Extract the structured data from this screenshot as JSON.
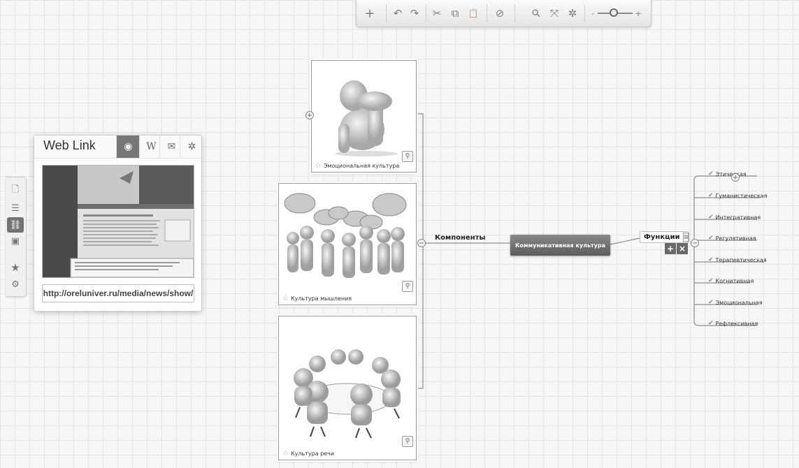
{
  "toolbar": {
    "add_icon": "+",
    "undo_icon": "↶",
    "redo_icon": "↷",
    "cut_icon": "✂",
    "copy_icon": "⧉",
    "paste_icon": "📋",
    "clear_icon": "⊘",
    "search_icon": "⚲",
    "fit_icon": "⤧",
    "layout_icon": "✲",
    "zoom_minus": "-",
    "zoom_plus": "+",
    "zoom_level": 0.45
  },
  "sidebar": {
    "items": [
      {
        "icon": "document-icon",
        "glyph": "🗋"
      },
      {
        "icon": "list-icon",
        "glyph": "☰"
      },
      {
        "icon": "link-icon",
        "glyph": "⛓"
      },
      {
        "icon": "image-icon",
        "glyph": "▣"
      },
      {
        "icon": "star-icon",
        "glyph": "★"
      },
      {
        "icon": "theme-icon",
        "glyph": "⚙"
      }
    ]
  },
  "weblink": {
    "title": "Web Link",
    "tabs": [
      {
        "icon": "web-icon",
        "glyph": "◉"
      },
      {
        "icon": "wikipedia-icon",
        "glyph": "W"
      },
      {
        "icon": "mail-icon",
        "glyph": "✉"
      },
      {
        "icon": "mindmap-icon",
        "glyph": "✲"
      }
    ],
    "url": "http://oreluniver.ru/media/news/show/"
  },
  "nodes": {
    "emotional": {
      "caption": "Эмоциональная культура"
    },
    "thinking": {
      "caption": "Культура мышления"
    },
    "speech": {
      "caption": "Культура речи"
    }
  },
  "central": {
    "label": "Коммуникативная культура"
  },
  "komponenty": {
    "label": "Компоненты"
  },
  "functions": {
    "label": "Функции",
    "add": "+",
    "remove": "×",
    "items": [
      "Этическая",
      "Гуманистическая",
      "Интегративная",
      "Регулятивная",
      "Терапевтическая",
      "Когнитивная",
      "Эмоциональная",
      "Рефлексивная"
    ]
  },
  "colors": {
    "central_bg": "#6e6e6e",
    "grid": "#e6e6e6",
    "active_tab": "#777777"
  }
}
